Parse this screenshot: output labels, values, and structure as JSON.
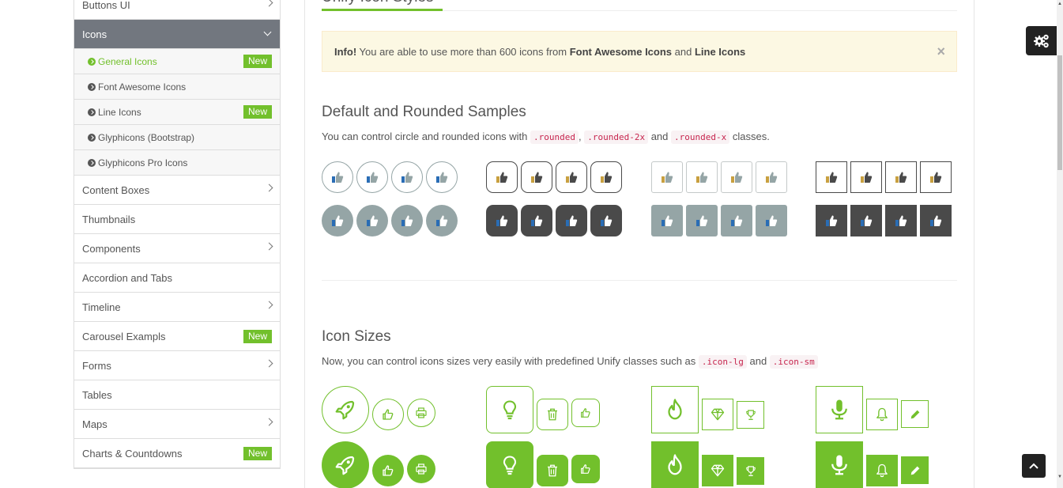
{
  "sidebar": {
    "items": [
      {
        "label": "Buttons UI",
        "has_chevron": true
      },
      {
        "label": "Icons",
        "active": true
      },
      {
        "label": "Content Boxes",
        "has_chevron": true
      },
      {
        "label": "Thumbnails"
      },
      {
        "label": "Components",
        "has_chevron": true
      },
      {
        "label": "Accordion and Tabs"
      },
      {
        "label": "Timeline",
        "has_chevron": true
      },
      {
        "label": "Carousel Exampls",
        "badge": "New"
      },
      {
        "label": "Forms",
        "has_chevron": true
      },
      {
        "label": "Tables"
      },
      {
        "label": "Maps",
        "has_chevron": true
      },
      {
        "label": "Charts & Countdowns",
        "badge": "New"
      }
    ],
    "sub_items": [
      {
        "label": "General Icons",
        "badge": "New",
        "current": true
      },
      {
        "label": "Font Awesome Icons"
      },
      {
        "label": "Line Icons",
        "badge": "New"
      },
      {
        "label": "Glyphicons (Bootstrap)"
      },
      {
        "label": "Glyphicons Pro Icons"
      }
    ]
  },
  "main": {
    "top_title": "Unify Icon Styles",
    "alert": {
      "strong": "Info!",
      "text1": " You are able to use more than 600 icons from ",
      "bold1": "Font Awesome Icons",
      "text2": " and ",
      "bold2": "Line Icons",
      "close": "×"
    },
    "section1": {
      "title": "Default and Rounded Samples",
      "text1": "You can control circle and rounded icons with ",
      "code1": ".rounded",
      "sep1": ", ",
      "code2": ".rounded-2x",
      "text2": " and ",
      "code3": ".rounded-x",
      "text3": " classes."
    },
    "section2": {
      "title": "Icon Sizes",
      "text1": "Now, you can control icons sizes very easily with predefined Unify classes such as ",
      "code1": ".icon-lg",
      "text2": " and ",
      "code2": ".icon-sm"
    }
  },
  "colors": {
    "accent": "#72c02c",
    "grey_icon": "#95a5a6",
    "dark_icon": "#4a4a4a",
    "sidebar_active": "#72777f"
  }
}
